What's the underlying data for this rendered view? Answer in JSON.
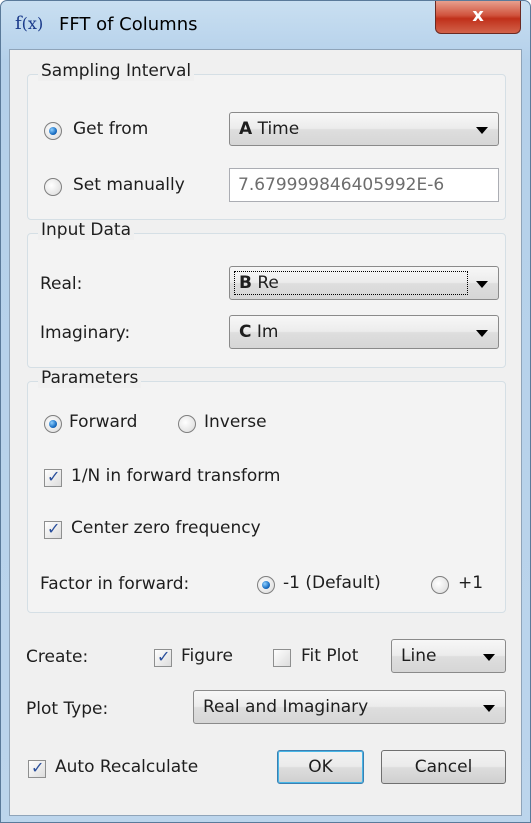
{
  "window": {
    "title": "FFT of Columns",
    "icon": "function-fx-icon",
    "close_label": "x"
  },
  "sampling": {
    "title": "Sampling Interval",
    "get_from_label": "Get from",
    "get_from_selected": true,
    "get_from_combo": {
      "key": "A",
      "name": "Time"
    },
    "set_manually_label": "Set manually",
    "set_manually_value": "7.679999846405992E-6"
  },
  "input": {
    "title": "Input Data",
    "real_label": "Real:",
    "real_combo": {
      "key": "B",
      "name": "Re"
    },
    "imag_label": "Imaginary:",
    "imag_combo": {
      "key": "C",
      "name": "Im"
    }
  },
  "params": {
    "title": "Parameters",
    "forward_label": "Forward",
    "inverse_label": "Inverse",
    "direction": "forward",
    "one_over_n_label": "1/N in forward transform",
    "one_over_n_checked": true,
    "center_zero_label": "Center zero frequency",
    "center_zero_checked": true,
    "factor_label": "Factor in forward:",
    "factor_minus1_label": "-1 (Default)",
    "factor_plus1_label": "+1",
    "factor": "-1"
  },
  "create": {
    "label": "Create:",
    "figure_label": "Figure",
    "figure_checked": true,
    "fitplot_label": "Fit Plot",
    "fitplot_checked": false,
    "plot_style": "Line"
  },
  "plot_type": {
    "label": "Plot Type:",
    "value": "Real and Imaginary"
  },
  "bottom": {
    "auto_recalc_label": "Auto Recalculate",
    "auto_recalc_checked": true,
    "ok_label": "OK",
    "cancel_label": "Cancel"
  }
}
